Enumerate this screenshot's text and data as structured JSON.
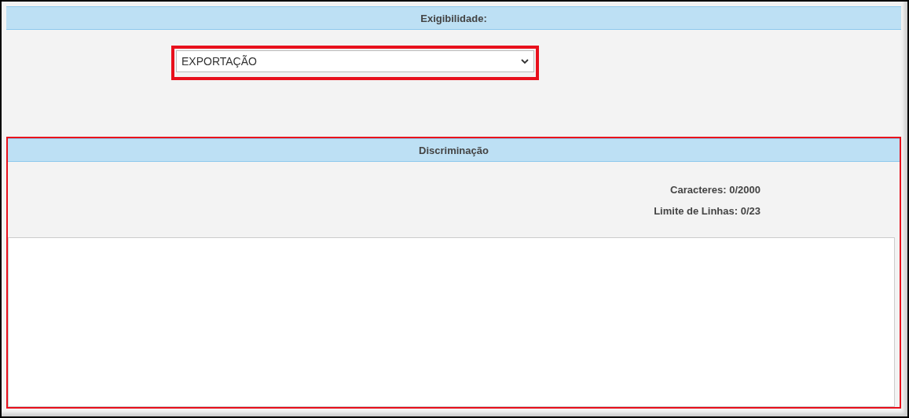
{
  "exigibilidade": {
    "title": "Exigibilidade:",
    "select": {
      "value": "EXPORTAÇÃO",
      "highlighted": true
    }
  },
  "discriminacao": {
    "title": "Discriminação",
    "highlighted": true,
    "counters": [
      "Caracteres: 0/2000",
      "Limite de Linhas: 0/23"
    ]
  }
}
